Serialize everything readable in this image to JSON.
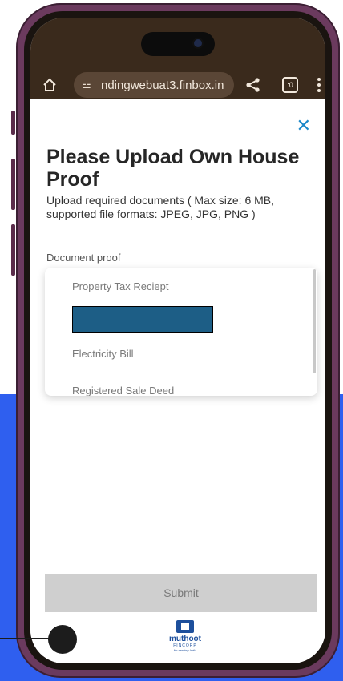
{
  "browser": {
    "url": "ndingwebuat3.finbox.in",
    "tune_icon": "⚍"
  },
  "page": {
    "close_icon": "✕",
    "title": "Please Upload Own House Proof",
    "subtitle": "Upload required documents ( Max size: 6 MB, supported file formats: JPEG, JPG, PNG )",
    "document_label": "Document proof",
    "options": [
      "Property Tax Reciept",
      "Electricity Bill",
      "Registered Sale Deed"
    ],
    "submit_label": "Submit"
  },
  "brand": {
    "name": "muthoot",
    "sub": "FINCORP",
    "tagline": "for serving India"
  },
  "colors": {
    "accent": "#1b88c9",
    "background_blue": "#2f5fef",
    "phone_frame": "#6b3a5e",
    "browser_bar": "#3a2a1c"
  }
}
